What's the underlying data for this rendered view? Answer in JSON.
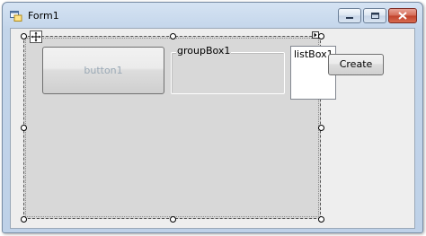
{
  "window": {
    "title": "Form1",
    "icon": "form-app-icon",
    "controls": [
      "minimize-icon",
      "maximize-icon",
      "close-icon"
    ]
  },
  "designer": {
    "panel_move_glyph": "move-arrows-icon",
    "button1_label": "button1",
    "groupbox_label": "groupBox1",
    "listbox_label": "listBox1",
    "smart_tag": "smart-tag-arrow-icon"
  },
  "actions": {
    "create_label": "Create"
  },
  "colors": {
    "client_bg": "#eeeeee",
    "panel_bg": "#d8d8d8",
    "close_btn": "#c0412b",
    "disabled_text": "#9aa9b6"
  }
}
